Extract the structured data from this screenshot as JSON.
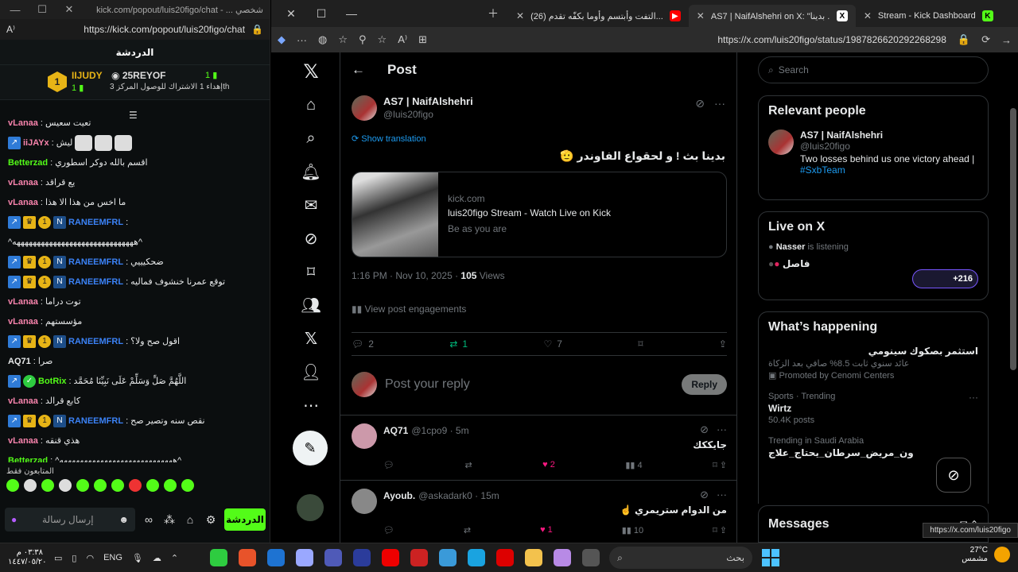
{
  "chat": {
    "window_title": "kick.com/popout/luis20figo/chat - ... شخصي",
    "url": "https://kick.com/popout/luis20figo/chat",
    "header": "الدردشة",
    "leader1": {
      "rank": "1",
      "name": "IIJUDY",
      "count": "1"
    },
    "leader2": {
      "name": "25REYOF",
      "count": "1",
      "sub": "إهداء 1 الاشتراك للوصول المركز 3"
    },
    "leader2_suffix": "th",
    "messages": [
      {
        "user": "vLanaa",
        "color": "#f783ac",
        "text": "تعيت سعيس",
        "badges": []
      },
      {
        "user": "iiJAYx",
        "color": "#f783ac",
        "text": "ليش",
        "badges": [
          "blue"
        ],
        "emotes": 3
      },
      {
        "user": "Betterzad",
        "color": "#53fc18",
        "text": "اقسم بالله دوكر اسطوري",
        "badges": []
      },
      {
        "user": "vLanaa",
        "color": "#f783ac",
        "text": "يع قراقد",
        "badges": []
      },
      {
        "user": "vLanaa",
        "color": "#f783ac",
        "text": "ما اخس من هذا الا هذا",
        "badges": []
      },
      {
        "user": "RANEEMFRL",
        "color": "#3b82f6",
        "text": "",
        "badges": [
          "blue",
          "crown",
          "one",
          "n"
        ]
      },
      {
        "user": "",
        "color": "#e7e9ea",
        "text": "^ههههههههههههههههههههههههههههههه^",
        "badges": []
      },
      {
        "user": "RANEEMFRL",
        "color": "#3b82f6",
        "text": "ضحكيييي",
        "badges": [
          "blue",
          "crown",
          "one",
          "n"
        ]
      },
      {
        "user": "RANEEMFRL",
        "color": "#3b82f6",
        "text": "توقع عمرنا خنشوف فماليه",
        "badges": [
          "blue",
          "crown",
          "one",
          "n"
        ]
      },
      {
        "user": "vLanaa",
        "color": "#f783ac",
        "text": "توت دراما",
        "badges": []
      },
      {
        "user": "vLanaa",
        "color": "#f783ac",
        "text": "مؤسستهم",
        "badges": []
      },
      {
        "user": "RANEEMFRL",
        "color": "#3b82f6",
        "text": "اقول صح ولا؟",
        "badges": [
          "blue",
          "crown",
          "one",
          "n"
        ]
      },
      {
        "user": "AQ71",
        "color": "#e7e9ea",
        "text": "صرا",
        "badges": []
      },
      {
        "user": "BotRix",
        "color": "#53fc18",
        "text": "اللَّهُمَّ صَلِّ وَسَلِّمْ عَلَى نَبِيِّنَا مُحَمَّد",
        "badges": [
          "blue",
          "green"
        ]
      },
      {
        "user": "vLanaa",
        "color": "#f783ac",
        "text": "كابع قرالد",
        "badges": []
      },
      {
        "user": "RANEEMFRL",
        "color": "#3b82f6",
        "text": "نقص سنه وتصير صح",
        "badges": [
          "blue",
          "crown",
          "one",
          "n"
        ]
      },
      {
        "user": "vLanaa",
        "color": "#f783ac",
        "text": "هذي قنقه",
        "badges": []
      },
      {
        "user": "Betterzad",
        "color": "#53fc18",
        "text": "^ههههههههههههههههههههههههههههه^",
        "badges": []
      }
    ],
    "emotes_label": "المتابعون فقط",
    "input_placeholder": "إرسال رسالة",
    "chat_button": "الدردشة"
  },
  "browser": {
    "tabs": [
      {
        "label": "Stream - Kick Dashboard",
        "icon": "kick-icon"
      },
      {
        "label": "AS7 | NaifAlshehri on X: \"بدينا ...",
        "icon": "x-icon",
        "active": true
      },
      {
        "label": "(26) التفت وأبتسم وأوما بكفّه تقدم...",
        "icon": "youtube-icon"
      }
    ],
    "url": "https://x.com/luis20figo/status/1987826620292268298"
  },
  "x": {
    "page_title": "Post",
    "author": {
      "name": "AS7 | NaifAlshehri",
      "handle": "@luis20figo"
    },
    "show_translation": "Show translation",
    "text": "بدينا بث ! و لحقواع الفاوندر 🫡",
    "card": {
      "domain": "kick.com",
      "title": "luis20figo Stream - Watch Live on Kick",
      "subtitle": "Be as you are"
    },
    "timestamp": "1:16 PM · Nov 10, 2025 · ",
    "views": "105",
    "views_label": " Views",
    "view_engagements": "View post engagements",
    "counts": {
      "replies": "2",
      "reposts": "1",
      "likes": "7"
    },
    "reply_placeholder": "Post your reply",
    "reply_button": "Reply",
    "replies": [
      {
        "name": "AQ71",
        "handle": "@1cpo9 · 5m",
        "text": "جايككك",
        "likes": "2",
        "views": "4"
      },
      {
        "name": "Ayoub.",
        "handle": "@askadark0 · 15m",
        "text": "من الدوام ستريمري ☝️",
        "likes": "1",
        "views": "10"
      }
    ],
    "search_placeholder": "Search",
    "relevant": {
      "title": "Relevant people",
      "name": "AS7 | NaifAlshehri",
      "handle": "@luis20figo",
      "bio": "Two losses behind us one victory ahead | ",
      "hashtag": "#SxbTeam"
    },
    "live": {
      "title": "Live on X",
      "host": "Nasser",
      "status": " is listening",
      "space_title": "فاصل",
      "count": "+216"
    },
    "whats_happening": {
      "title": "What’s happening",
      "promo_title": "استثمر بصكوك سينومي",
      "promo_sub": "عائد سنوي ثابت 8.5% صافي بعد الزكاة",
      "promo_by": "Promoted by Cenomi Centers",
      "trends": [
        {
          "context": "Sports · Trending",
          "title": "Wirtz",
          "posts": "50.4K posts"
        },
        {
          "context": "Trending in Saudi Arabia",
          "title": "ون_مريض_سرطان_يحتاج_علاج",
          "posts": ""
        }
      ]
    },
    "messages_label": "Messages",
    "status_url": "https://x.com/luis20figo"
  },
  "taskbar": {
    "time": "٠٣:٣٨ م",
    "date": "١٤٤٧/٠٥/٢٠",
    "lang": "ENG",
    "search": "بحث",
    "temp": "27°C",
    "weather": "مشمس"
  },
  "colors": {
    "kick_green": "#53fc18",
    "x_blue": "#1d9bf0",
    "like_pink": "#f91880",
    "repost_green": "#00ba7c"
  }
}
